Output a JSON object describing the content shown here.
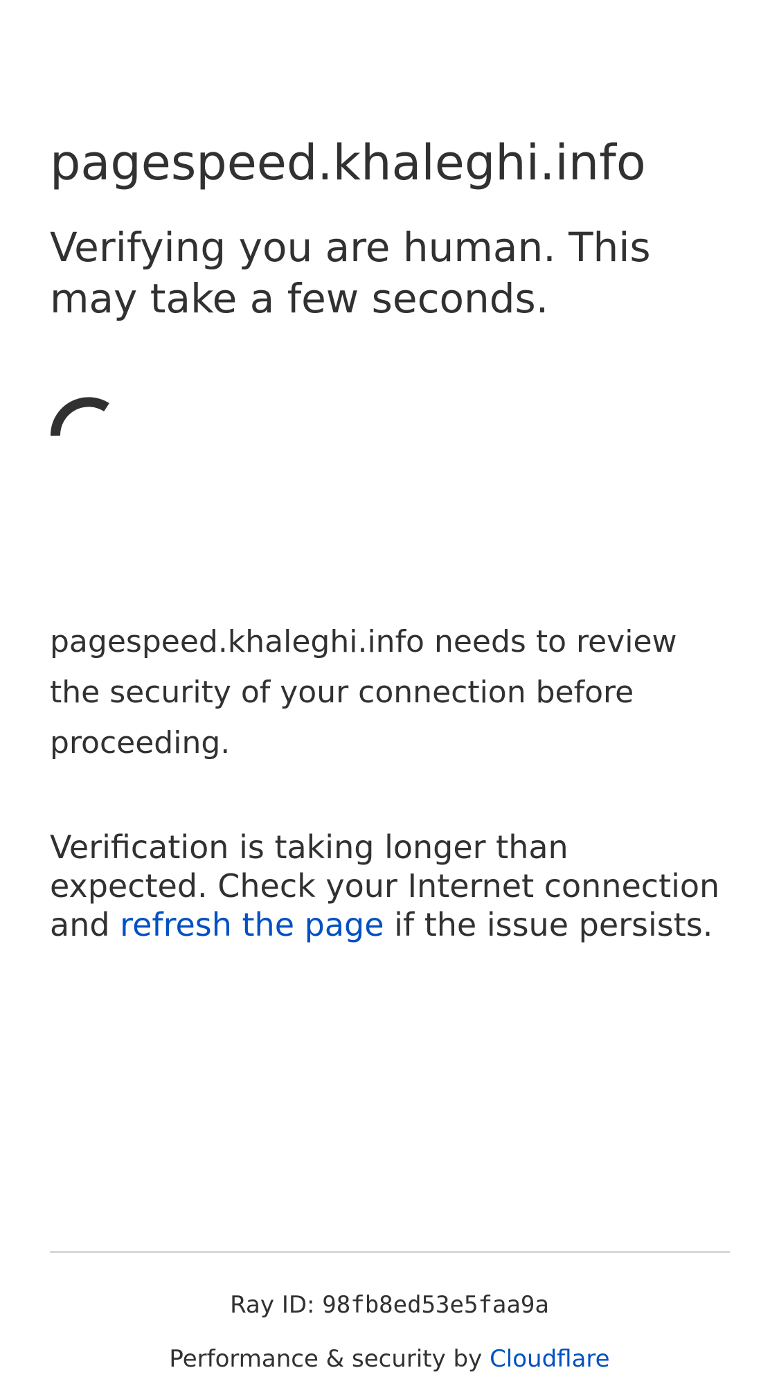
{
  "site": {
    "domain": "pagespeed.khaleghi.info"
  },
  "challenge": {
    "headline": "Verifying you are human. This may take a few seconds.",
    "review_text": "pagespeed.khaleghi.info needs to review the security of your connection before proceeding.",
    "warning_before": "Verification is taking longer than expected. Check your Internet connection and ",
    "refresh_link": "refresh the page",
    "warning_after": " if the issue persists."
  },
  "footer": {
    "ray_label": "Ray ID: ",
    "ray_id": "98fb8ed53e5faa9a",
    "performance_label": "Performance & security by ",
    "cloudflare_link": "Cloudflare"
  },
  "colors": {
    "text": "#313131",
    "link": "#0051c3",
    "divider": "#d9d9d9",
    "background": "#ffffff"
  },
  "icons": {
    "spinner": "loading-spinner-icon"
  }
}
